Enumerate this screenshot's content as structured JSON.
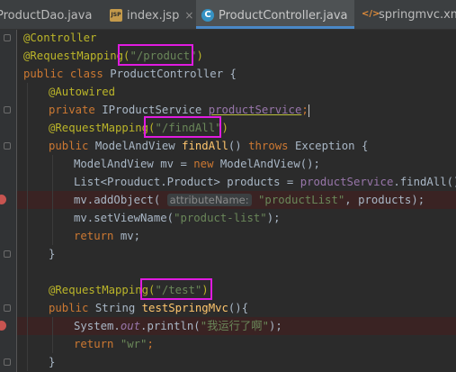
{
  "tabs": [
    {
      "label": "ProductDao.java",
      "icon": "java-file-icon"
    },
    {
      "label": "index.jsp",
      "icon": "jsp-file-icon",
      "icon_text": "JSP"
    },
    {
      "label": "ProductController.java",
      "icon": "class-file-icon",
      "icon_text": "C",
      "active": true
    },
    {
      "label": "springmvc.xml",
      "icon": "xml-file-icon"
    }
  ],
  "tab_close_glyph": "×",
  "code": {
    "l1_ann": "@Controller",
    "l2_ann": "@RequestMapping(",
    "l2_str": "\"/product\"",
    "l2_end": ")",
    "l3_kw": "public class ",
    "l3_rest": "ProductController {",
    "l4_ann": "@Autowired",
    "l5_kw": "private ",
    "l5_type": "IProductService ",
    "l5_field": "productService",
    "l5_end": ";",
    "l6_ann": "@RequestMapping(",
    "l6_str": "\"/findAll\"",
    "l6_end": ")",
    "l7_kw": "public ",
    "l7_type": "ModelAndView ",
    "l7_fn": "findAll",
    "l7_mid": "() ",
    "l7_kw2": "throws ",
    "l7_end": "Exception {",
    "l8_a": "ModelAndView mv = ",
    "l8_kw": "new ",
    "l8_b": "ModelAndView();",
    "l9_a": "List<Prouduct.Product> products = ",
    "l9_field": "productService",
    "l9_b": ".findAll();",
    "l10_a": "mv.addObject( ",
    "l10_hint": "attributeName:",
    "l10_str": " \"productList\"",
    "l10_b": ", products);",
    "l11_a": "mv.setViewName(",
    "l11_str": "\"product-list\"",
    "l11_b": ");",
    "l12_kw": "return ",
    "l12_b": "mv;",
    "l13": "}",
    "l15_ann": "@RequestMapping(",
    "l15_str": "\"/test\"",
    "l15_end": ")",
    "l16_kw": "public ",
    "l16_type": "String ",
    "l16_fn": "testSpringMvc",
    "l16_end": "(){",
    "l17_a": "System.",
    "l17_out": "out",
    "l17_b": ".println(",
    "l17_str": "\"我运行了啊\"",
    "l17_end": ");",
    "l18_kw": "return ",
    "l18_str": "\"wr\"",
    "l18_end": ";",
    "l19": "}"
  }
}
